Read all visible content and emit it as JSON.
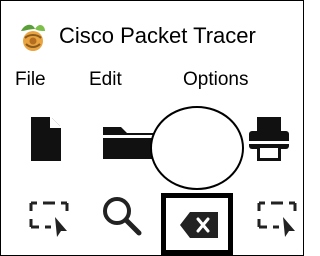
{
  "window": {
    "title": "Cisco Packet Tracer",
    "icon": "packet-tracer-app-icon"
  },
  "menubar": {
    "items": [
      {
        "label": "File"
      },
      {
        "label": "Edit"
      },
      {
        "label": "Options"
      }
    ]
  },
  "toolbar_main": {
    "buttons": [
      {
        "name": "new-file",
        "icon": "new-file-icon"
      },
      {
        "name": "open-folder",
        "icon": "folder-icon"
      },
      {
        "name": "highlight-mark",
        "icon": "ellipse-icon"
      },
      {
        "name": "print",
        "icon": "printer-icon"
      }
    ]
  },
  "toolbar_tools": {
    "buttons": [
      {
        "name": "select",
        "icon": "marquee-select-icon"
      },
      {
        "name": "inspect",
        "icon": "magnifier-icon"
      },
      {
        "name": "delete",
        "icon": "delete-icon",
        "selected": true
      },
      {
        "name": "resize-shape",
        "icon": "marquee-select-icon"
      }
    ]
  }
}
